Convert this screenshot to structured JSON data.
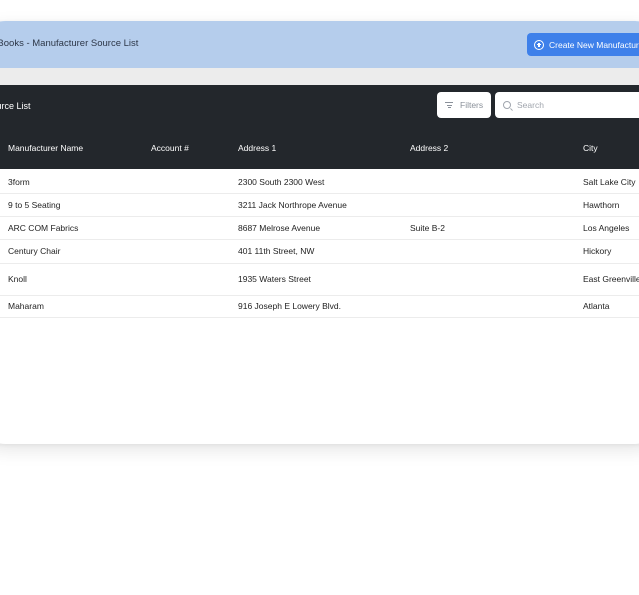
{
  "header": {
    "title": "ess Books - Manufacturer Source List",
    "create_label": "Create New Manufacturer"
  },
  "toolbar": {
    "section_title": "r Source List",
    "filters_label": "Filters",
    "search_placeholder": "Search"
  },
  "table": {
    "columns": [
      "Manufacturer Name",
      "Account #",
      "Address 1",
      "Address 2",
      "City"
    ],
    "rows": [
      {
        "name": "3form",
        "account": "",
        "address1": "2300 South 2300 West",
        "address2": "",
        "city": "Salt Lake City"
      },
      {
        "name": "9 to 5 Seating",
        "account": "",
        "address1": "3211 Jack Northrope Avenue",
        "address2": "",
        "city": "Hawthorn"
      },
      {
        "name": "ARC COM Fabrics",
        "account": "",
        "address1": "8687 Melrose Avenue",
        "address2": "Suite B-2",
        "city": "Los Angeles"
      },
      {
        "name": "Century Chair",
        "account": "",
        "address1": "401 11th Street, NW",
        "address2": "",
        "city": "Hickory"
      },
      {
        "name": "Knoll",
        "account": "",
        "address1": "1935 Waters Street",
        "address2": "",
        "city": "East Greenville"
      },
      {
        "name": "Maharam",
        "account": "",
        "address1": "916 Joseph E Lowery Blvd.",
        "address2": "",
        "city": "Atlanta"
      }
    ]
  },
  "colors": {
    "topbar": "#b5cdec",
    "accent": "#3e80ea",
    "dark_panel": "#23272c"
  }
}
